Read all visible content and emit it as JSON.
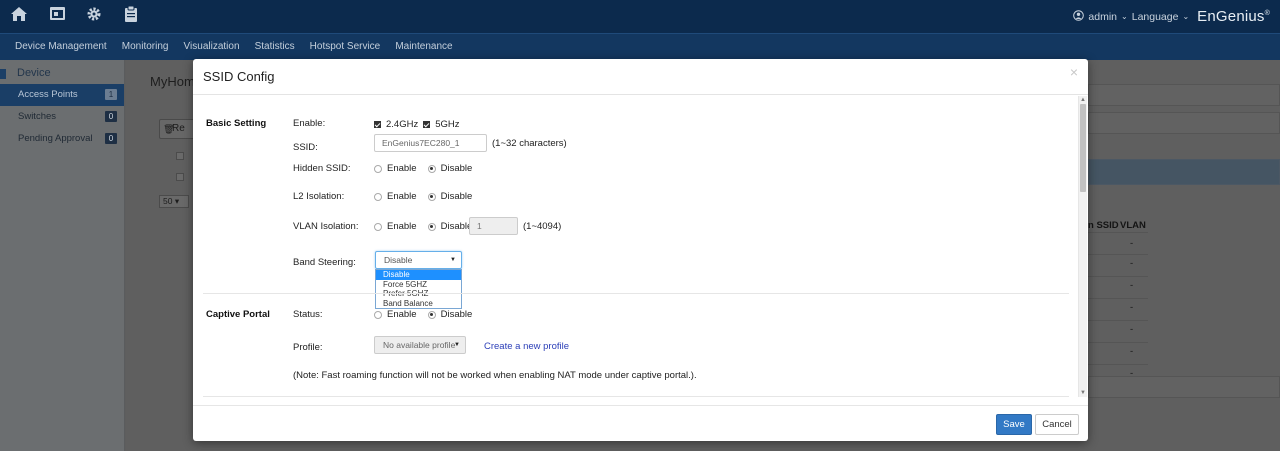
{
  "topbar": {
    "icons": [
      "home-icon",
      "monitor-icon",
      "gear-icon",
      "clipboard-icon"
    ],
    "user_icon": "user-circle-icon",
    "user": "admin",
    "language": "Language",
    "brand": "EnGenius",
    "brand_mark": "®"
  },
  "nav": {
    "items": [
      "Device Management",
      "Monitoring",
      "Visualization",
      "Statistics",
      "Hotspot Service",
      "Maintenance"
    ]
  },
  "sidebar": {
    "section": "Device",
    "items": [
      {
        "label": "Access Points",
        "count": "1"
      },
      {
        "label": "Switches",
        "count": "0"
      },
      {
        "label": "Pending Approval",
        "count": "0"
      }
    ]
  },
  "content": {
    "title": "MyHome",
    "remove_button": "Re",
    "page_size": "50",
    "table_headers": [
      "n SSID",
      "VLAN"
    ],
    "vlan_placeholder": "-"
  },
  "modal": {
    "title": "SSID Config",
    "close": "×",
    "basic": {
      "section": "Basic Setting",
      "enable_label": "Enable:",
      "band_24": "2.4GHz",
      "band_5": "5GHz",
      "ssid_label": "SSID:",
      "ssid_value": "EnGenius7EC280_1",
      "ssid_hint": "(1~32 characters)",
      "hidden_label": "Hidden SSID:",
      "l2_label": "L2 Isolation:",
      "vlan_label": "VLAN Isolation:",
      "vlan_value": "1",
      "vlan_hint": "(1~4094)",
      "enable_opt": "Enable",
      "disable_opt": "Disable",
      "band_steering_label": "Band Steering:",
      "band_steering_value": "Disable",
      "band_steering_options": [
        "Disable",
        "Force 5GHZ",
        "Prefer 5GHZ",
        "Band Balance"
      ]
    },
    "captive": {
      "section": "Captive Portal",
      "status_label": "Status:",
      "profile_label": "Profile:",
      "profile_value": "No available profile",
      "create_link": "Create a new profile",
      "note": "(Note: Fast roaming function will not be worked when enabling NAT mode under captive portal.)."
    },
    "footer": {
      "save": "Save",
      "cancel": "Cancel"
    }
  }
}
